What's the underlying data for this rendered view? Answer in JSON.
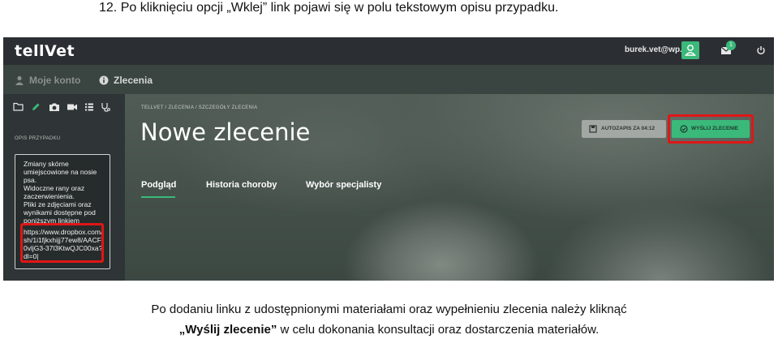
{
  "doc": {
    "heading": "12.  Po kliknięciu opcji „Wklej” link pojawi się w polu tekstowym opisu przypadku.",
    "caption_line1": "Po dodaniu linku z udostępnionymi materiałami oraz wypełnieniu zlecenia należy kliknąć",
    "caption_line2_bold": "„Wyślij zlecenie”",
    "caption_line2_rest": " w celu dokonania konsultacji oraz dostarczenia materiałów."
  },
  "app": {
    "logo": "tellVet",
    "user_email": "burek.vet@wp.pl",
    "notification_count": "1",
    "nav": [
      {
        "label": "Moje konto",
        "icon": "user-icon"
      },
      {
        "label": "Zlecenia",
        "icon": "info-icon"
      }
    ],
    "toolbar_icons": [
      "folder-icon",
      "pencil-icon",
      "camera-icon",
      "video-icon",
      "list-icon",
      "stethoscope-icon"
    ],
    "sidebar_label": "OPIS PRZYPADKU",
    "description_text": "Zmiany skórne umiejscowione na nosie psa.\nWidoczne rany oraz zaczerwienienia.\nPliki ze zdjęciami oraz wynikami dostępne pod poniższym linkiem",
    "description_link": "https://www.dropbox.com/sh/1i1fjkxhijj77ew8/AACF0vljG3-37l3KtwQJC00xa?dl=0|",
    "breadcrumb": "TELLVET  /  ZLECENIA  /  SZCZEGÓŁY ZLECENIA",
    "page_title": "Nowe zlecenie",
    "autosave_label": "AUTOZAPIS ZA 04:12",
    "send_label": "WYŚLIJ ZLECENIE",
    "tabs": [
      "Podgląd",
      "Historia choroby",
      "Wybór specjalisty"
    ],
    "active_tab": "Podgląd"
  },
  "colors": {
    "accent_green": "#3bb97a",
    "highlight_red": "#e01616",
    "topbar": "#2b2f33"
  }
}
